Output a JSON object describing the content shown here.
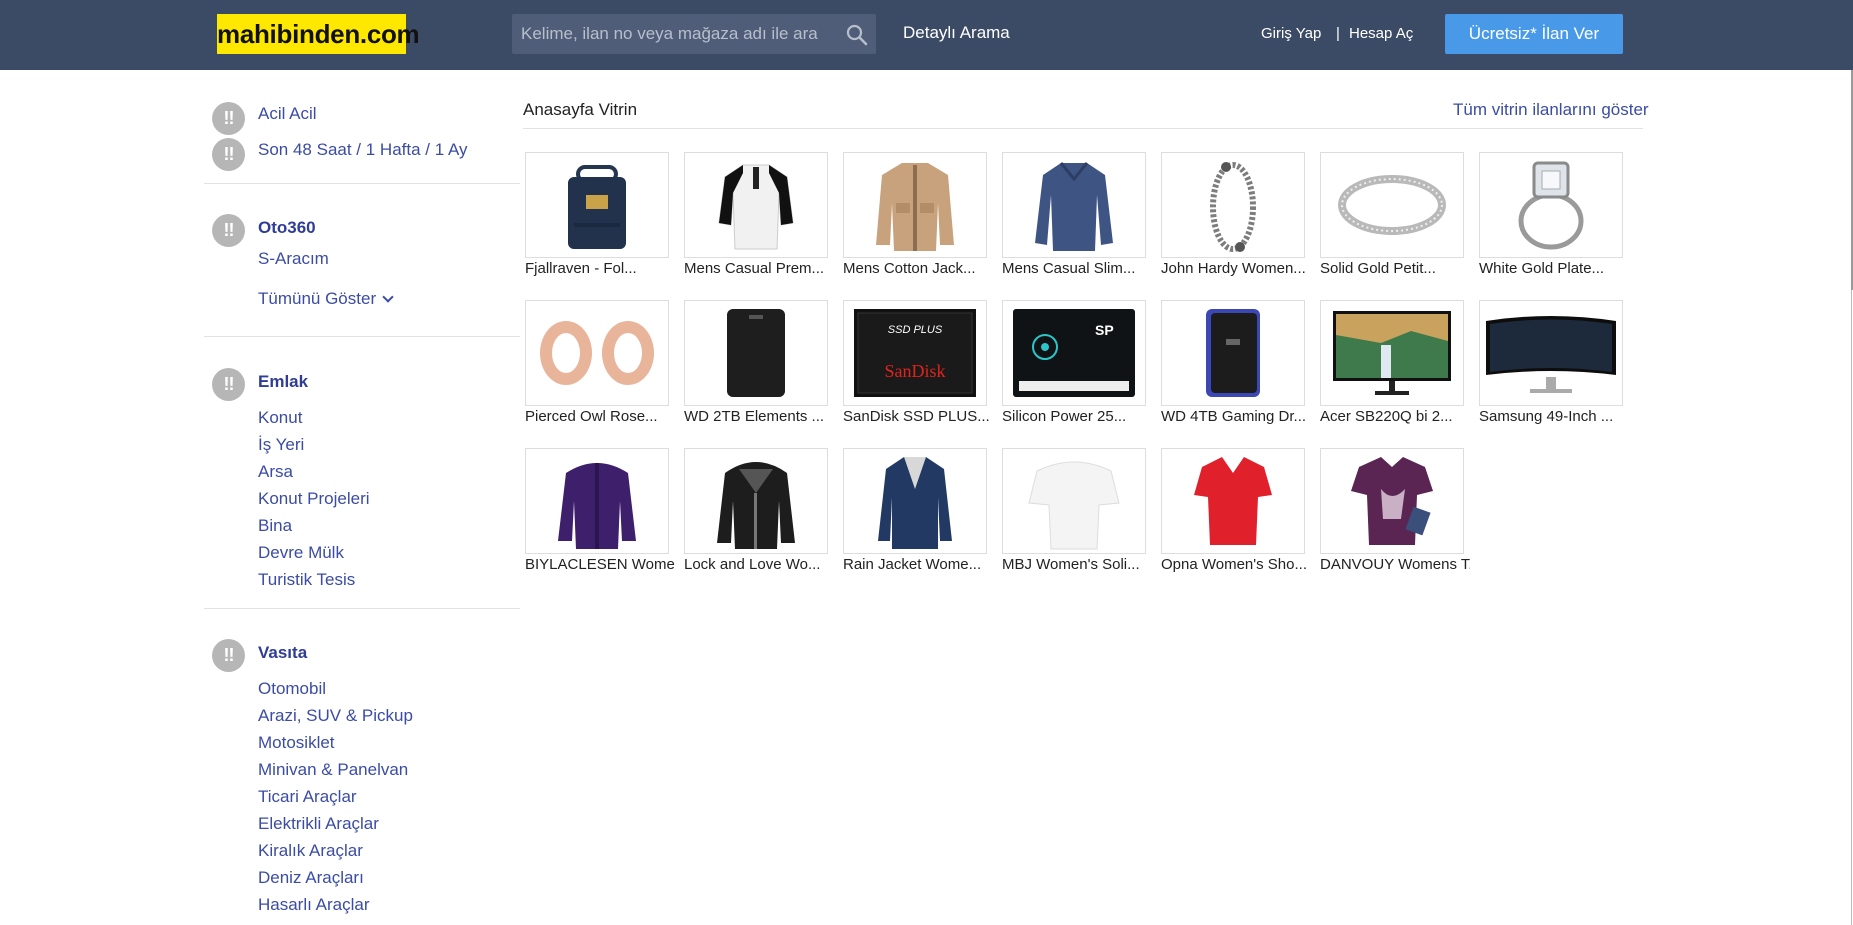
{
  "header": {
    "logo": "mahibinden.com",
    "search_placeholder": "Kelime, ilan no veya mağaza adı ile ara",
    "detailed_search": "Detaylı Arama",
    "login": "Giriş Yap",
    "separator": "|",
    "register": "Hesap Aç",
    "post_ad": "Ücretsiz* İlan Ver"
  },
  "sidebar": {
    "badge_text": "!!",
    "urgent": "Acil Acil",
    "recent": "Son 48 Saat / 1 Hafta / 1 Ay",
    "oto360": {
      "title": "Oto360",
      "items": [
        "S-Aracım"
      ],
      "show_all": "Tümünü Göster"
    },
    "emlak": {
      "title": "Emlak",
      "items": [
        "Konut",
        "İş Yeri",
        "Arsa",
        "Konut Projeleri",
        "Bina",
        "Devre Mülk",
        "Turistik Tesis"
      ]
    },
    "vasita": {
      "title": "Vasıta",
      "items": [
        "Otomobil",
        "Arazi, SUV & Pickup",
        "Motosiklet",
        "Minivan & Panelvan",
        "Ticari Araçlar",
        "Elektrikli Araçlar",
        "Kiralık Araçlar",
        "Deniz Araçları",
        "Hasarlı Araçlar"
      ]
    }
  },
  "showcase": {
    "title": "Anasayfa Vitrin",
    "show_all": "Tüm vitrin ilanlarını göster",
    "items": [
      "Fjallraven - Fol...",
      "Mens Casual Prem...",
      "Mens Cotton Jack...",
      "Mens Casual Slim...",
      "John Hardy Women...",
      "Solid Gold Petit...",
      "White Gold Plate...",
      "Pierced Owl Rose...",
      "WD 2TB Elements ...",
      "SanDisk SSD PLUS...",
      "Silicon Power 25...",
      "WD 4TB Gaming Dr...",
      "Acer SB220Q bi 2...",
      "Samsung 49-Inch ...",
      "BIYLACLESEN Wome...",
      "Lock and Love Wo...",
      "Rain Jacket Wome...",
      "MBJ Women's Soli...",
      "Opna Women's Sho...",
      "DANVOUY Womens T..."
    ],
    "image_labels": {
      "ssd_brand": "SanDisk",
      "ssd_line": "SSD PLUS",
      "sp_brand": "SP"
    }
  },
  "colors": {
    "header_bg": "#3c4b65",
    "logo_bg": "#ffe800",
    "post_button": "#489ae9",
    "link": "#3b4ca5",
    "badge": "#b6b6b6"
  },
  "icons": {
    "search": "search-icon",
    "chevron": "chevron-down-icon",
    "badge": "exclamation-badge-icon"
  }
}
